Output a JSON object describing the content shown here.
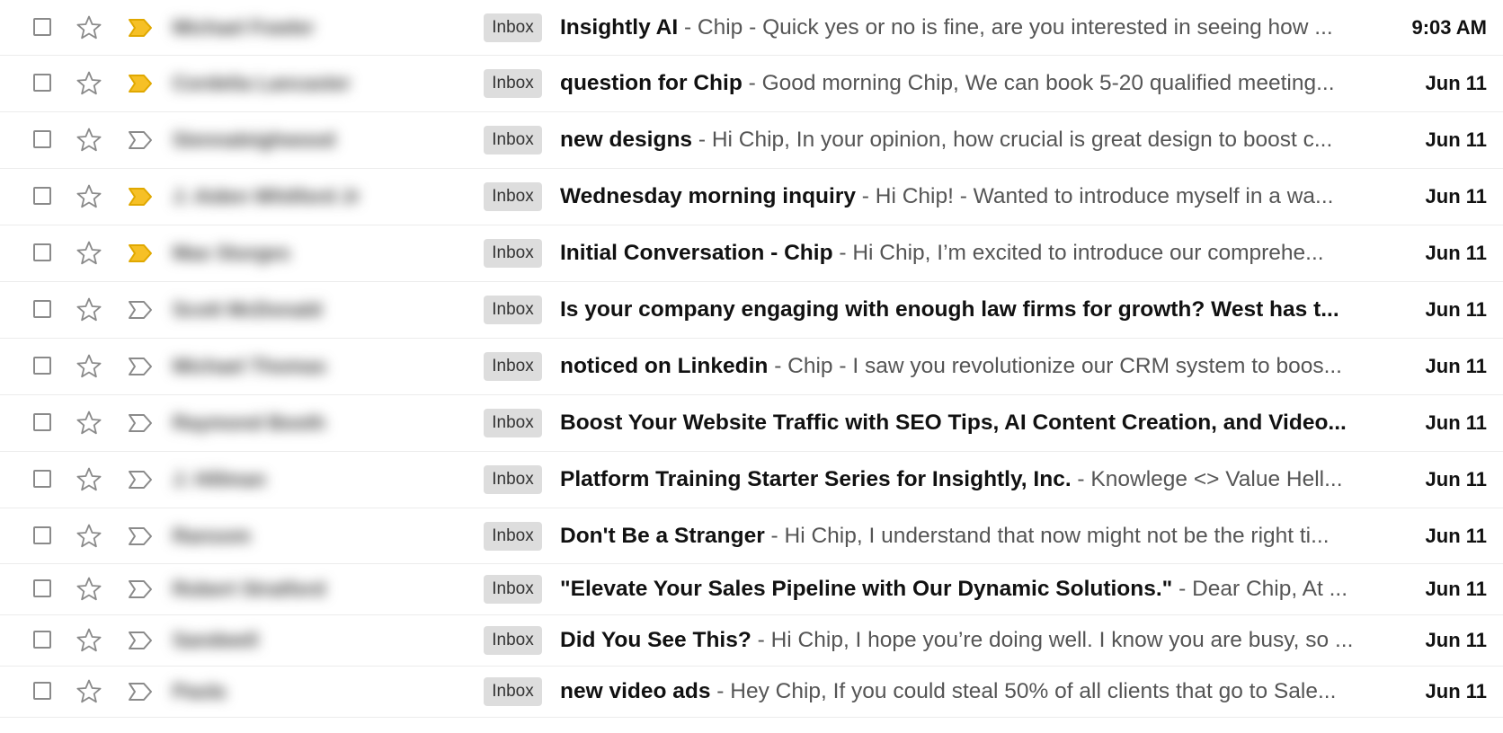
{
  "badge_label": "Inbox",
  "colors": {
    "important_marker": "#f6c026",
    "badge_bg": "#dddddd",
    "row_divider": "#ececec"
  },
  "rows": [
    {
      "sender": "Michael Fowler",
      "subject": "Insightly AI",
      "snippet": "Chip - Quick yes or no is fine, are you interested in seeing how ...",
      "date": "9:03 AM",
      "important": true
    },
    {
      "sender": "Cordelia Lancaster",
      "subject": "question for Chip",
      "snippet": "Good morning Chip, We can book 5-20 qualified meeting...",
      "date": "Jun 11",
      "important": true
    },
    {
      "sender": "Siennaleighwood",
      "subject": "new designs",
      "snippet": "Hi Chip, In your opinion, how crucial is great design to boost c...",
      "date": "Jun 11",
      "important": false
    },
    {
      "sender": "J. Aiden Whitford Jr",
      "subject": "Wednesday morning inquiry",
      "snippet": "Hi Chip! - Wanted to introduce myself in a wa...",
      "date": "Jun 11",
      "important": true
    },
    {
      "sender": "Max Sturges",
      "subject": "Initial Conversation - Chip",
      "snippet": "Hi Chip, I’m excited to introduce our comprehe...",
      "date": "Jun 11",
      "important": true
    },
    {
      "sender": "Scott McDonald",
      "subject": "Is your company engaging with enough law firms for growth? West has t...",
      "snippet": "",
      "date": "Jun 11",
      "important": false
    },
    {
      "sender": "Michael Thomas",
      "subject": "noticed on Linkedin",
      "snippet": "Chip - I saw you revolutionize our CRM system to boos...",
      "date": "Jun 11",
      "important": false
    },
    {
      "sender": "Raymond Booth",
      "subject": "Boost Your Website Traffic with SEO Tips, AI Content Creation, and Video...",
      "snippet": "",
      "date": "Jun 11",
      "important": false
    },
    {
      "sender": "J. Hillman",
      "subject": "Platform Training Starter Series for Insightly, Inc.",
      "snippet": "Knowlege <> Value Hell...",
      "date": "Jun 11",
      "important": false
    },
    {
      "sender": "Ransom",
      "subject": "Don't Be a Stranger",
      "snippet": "Hi Chip, I understand that now might not be the right ti...",
      "date": "Jun 11",
      "important": false
    },
    {
      "sender": "Robert Stratford",
      "subject": "\"Elevate Your Sales Pipeline with Our Dynamic Solutions.\"",
      "snippet": "Dear Chip, At ...",
      "date": "Jun 11",
      "important": false
    },
    {
      "sender": "Sandwell",
      "subject": "Did You See This?",
      "snippet": "Hi Chip, I hope you’re doing well. I know you are busy, so ...",
      "date": "Jun 11",
      "important": false
    },
    {
      "sender": "Paula",
      "subject": "new video ads",
      "snippet": "Hey Chip, If you could steal 50% of all clients that go to Sale...",
      "date": "Jun 11",
      "important": false
    }
  ]
}
